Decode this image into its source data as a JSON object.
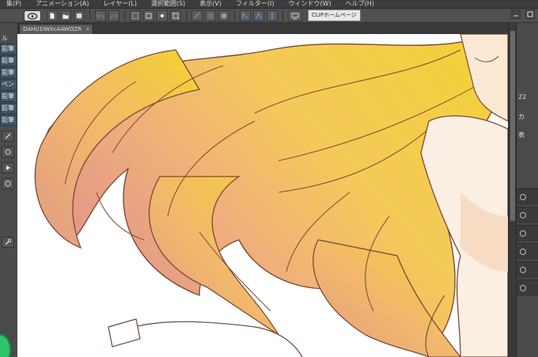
{
  "menu": {
    "items": [
      "集(P)",
      "アニメーション(A)",
      "レイヤー(L)",
      "選択範囲(S)",
      "表示(V)",
      "フィルター(I)",
      "ウィンドウ(W)",
      "ヘルプ(H)"
    ]
  },
  "toolbar": {
    "clip_home_label": "CLIPホームページ"
  },
  "document": {
    "tab_title": "DAHU1IWXcAAWOZR",
    "tab_close": "×"
  },
  "left_panel": {
    "tab_label": "ル",
    "brushes": [
      "鉛筆",
      "鉛筆",
      "鉛筆",
      "ペン",
      "鉛筆",
      "鉛筆",
      "鉛筆"
    ]
  },
  "right_panel": {
    "zoom_text": "22",
    "label_1": "カ",
    "label_2": "表"
  },
  "colors": {
    "hair_yellow": "#f2cf32",
    "hair_orange": "#f0b46a",
    "hair_pink": "#e39a88",
    "lineart": "#7b4a36",
    "skin": "#f7dcc3",
    "accent_green": "#2fc46b"
  }
}
